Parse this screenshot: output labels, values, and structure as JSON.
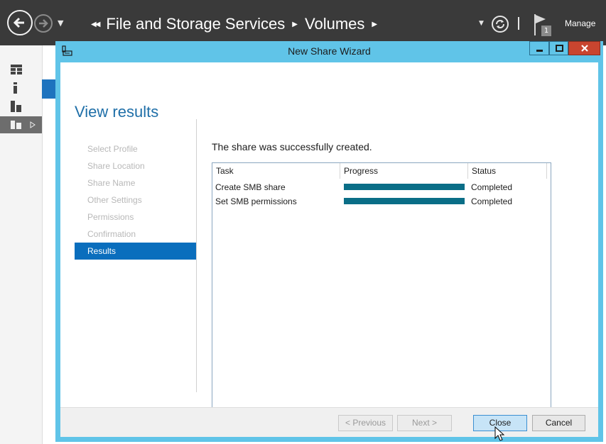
{
  "server_manager": {
    "breadcrumb": [
      "File and Storage Services",
      "Volumes"
    ],
    "notification_count": "1",
    "manage_label": "Manage"
  },
  "wizard": {
    "title": "New Share Wizard",
    "heading": "View results",
    "steps": [
      {
        "label": "Select Profile",
        "active": false
      },
      {
        "label": "Share Location",
        "active": false
      },
      {
        "label": "Share Name",
        "active": false
      },
      {
        "label": "Other Settings",
        "active": false
      },
      {
        "label": "Permissions",
        "active": false
      },
      {
        "label": "Confirmation",
        "active": false
      },
      {
        "label": "Results",
        "active": true
      }
    ],
    "message": "The share was successfully created.",
    "table": {
      "columns": [
        "Task",
        "Progress",
        "Status"
      ],
      "rows": [
        {
          "task": "Create SMB share",
          "progress": 1.0,
          "status": "Completed"
        },
        {
          "task": "Set SMB permissions",
          "progress": 1.0,
          "status": "Completed"
        }
      ]
    },
    "buttons": {
      "previous": "< Previous",
      "next": "Next >",
      "close": "Close",
      "cancel": "Cancel"
    }
  },
  "colors": {
    "accent": "#0a6ebd",
    "title_bar": "#60c4e8",
    "progress_fill": "#0a6e87",
    "header_bg": "#3a3a3a"
  }
}
